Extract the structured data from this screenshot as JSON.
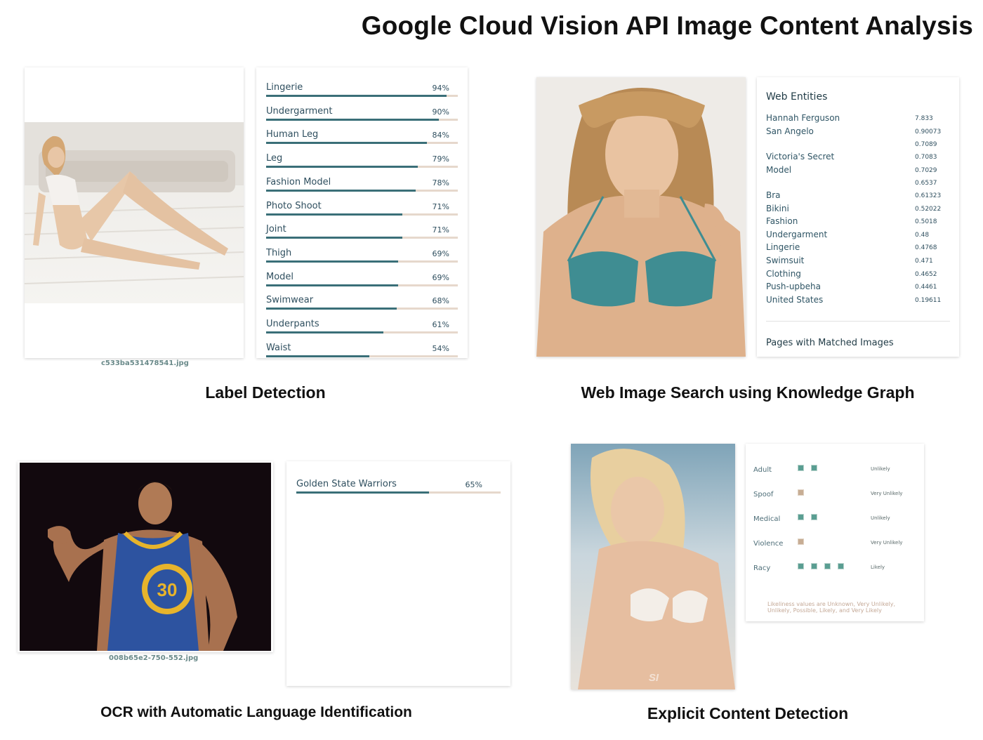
{
  "title": "Google Cloud Vision API Image Content Analysis",
  "label_detection": {
    "caption": "Label Detection",
    "filename": "c533ba531478541.jpg",
    "labels": [
      {
        "name": "Lingerie",
        "score": "94%",
        "value": 0.94
      },
      {
        "name": "Undergarment",
        "score": "90%",
        "value": 0.9
      },
      {
        "name": "Human Leg",
        "score": "84%",
        "value": 0.84
      },
      {
        "name": "Leg",
        "score": "79%",
        "value": 0.79
      },
      {
        "name": "Fashion Model",
        "score": "78%",
        "value": 0.78
      },
      {
        "name": "Photo Shoot",
        "score": "71%",
        "value": 0.71
      },
      {
        "name": "Joint",
        "score": "71%",
        "value": 0.71
      },
      {
        "name": "Thigh",
        "score": "69%",
        "value": 0.69
      },
      {
        "name": "Model",
        "score": "69%",
        "value": 0.69
      },
      {
        "name": "Swimwear",
        "score": "68%",
        "value": 0.68
      },
      {
        "name": "Underpants",
        "score": "61%",
        "value": 0.61
      },
      {
        "name": "Waist",
        "score": "54%",
        "value": 0.54
      }
    ]
  },
  "web_detection": {
    "caption": "Web Image Search using Knowledge Graph",
    "heading": "Web Entities",
    "entities": [
      {
        "name": "Hannah Ferguson",
        "score": "7.833"
      },
      {
        "name": "San Angelo",
        "score": "0.90073"
      },
      {
        "name": "",
        "score": "0.7089"
      },
      {
        "name": "Victoria's Secret",
        "score": "0.7083"
      },
      {
        "name": "Model",
        "score": "0.7029"
      },
      {
        "name": "",
        "score": "0.6537"
      },
      {
        "name": "Bra",
        "score": "0.61323"
      },
      {
        "name": "Bikini",
        "score": "0.52022"
      },
      {
        "name": "Fashion",
        "score": "0.5018"
      },
      {
        "name": "Undergarment",
        "score": "0.48"
      },
      {
        "name": "Lingerie",
        "score": "0.4768"
      },
      {
        "name": "Swimsuit",
        "score": "0.471"
      },
      {
        "name": "Clothing",
        "score": "0.4652"
      },
      {
        "name": "Push-upbeha",
        "score": "0.4461"
      },
      {
        "name": "United States",
        "score": "0.19611"
      }
    ],
    "pages_heading": "Pages with Matched Images"
  },
  "ocr": {
    "caption": "OCR with Automatic Language Identification",
    "filename": "008b65e2-750-552.jpg",
    "jersey_number": "30",
    "labels": [
      {
        "name": "Golden State Warriors",
        "score": "65%",
        "value": 0.65
      }
    ]
  },
  "safe_search": {
    "caption": "Explicit Content Detection",
    "watermark": "Sports Illustrated",
    "rows": [
      {
        "name": "Adult",
        "level": 2,
        "kind": "teal",
        "value": "Unlikely"
      },
      {
        "name": "Spoof",
        "level": 1,
        "kind": "tan",
        "value": "Very Unlikely"
      },
      {
        "name": "Medical",
        "level": 2,
        "kind": "teal",
        "value": "Unlikely"
      },
      {
        "name": "Violence",
        "level": 1,
        "kind": "tan",
        "value": "Very Unlikely"
      },
      {
        "name": "Racy",
        "level": 4,
        "kind": "teal",
        "value": "Likely"
      }
    ],
    "note": "Likeliness values are Unknown, Very Unlikely, Unlikely, Possible, Likely, and Very Likely"
  }
}
